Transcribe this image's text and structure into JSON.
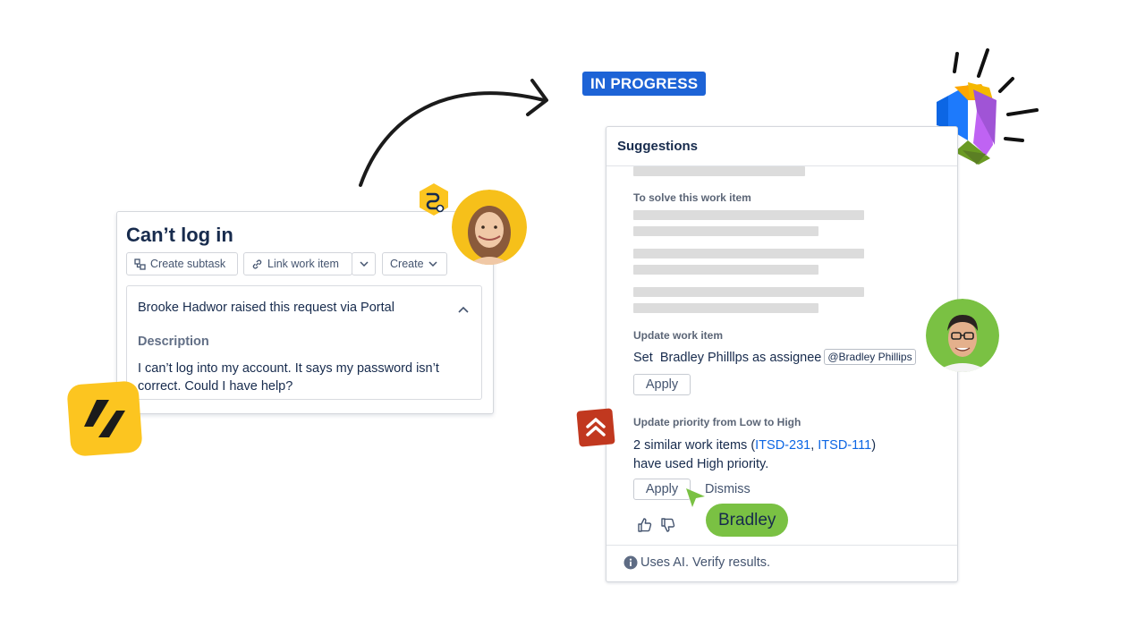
{
  "status_badge": "IN PROGRESS",
  "left_card": {
    "title": "Can’t log in",
    "toolbar": {
      "create_subtask": "Create subtask",
      "link_work_item": "Link work item",
      "create": "Create"
    },
    "raised_by": "Brooke Hadwor raised this request via Portal",
    "description_label": "Description",
    "description_text": "I can’t log into my account. It says my password isn’t correct. Could I have help?"
  },
  "suggestions": {
    "title": "Suggestions",
    "solve_label": "To solve this work item",
    "update_label": "Update work item",
    "update_text": "Set  Bradley Philllps as assignee",
    "mention": "@Bradley Phillips",
    "apply_label": "Apply",
    "priority_label": "Update priority from Low to High",
    "priority_text_prefix": "2 similar work items (",
    "link1": "ITSD-231",
    "comma": ", ",
    "link2": "ITSD-111",
    "priority_text_suffix": ")",
    "priority_text_line2": "have used High priority.",
    "dismiss_label": "Dismiss",
    "footer": "Uses AI. Verify results."
  },
  "cursor_label": "Bradley",
  "colors": {
    "badge_blue": "#1d63d6",
    "link_blue": "#0c66e4",
    "cursor_green": "#7ac143",
    "logo_yellow": "#fcc520",
    "priority_red": "#c1381f"
  },
  "icons": [
    "curved-arrow-icon",
    "subtask-icon",
    "link-icon",
    "chevron-down-icon",
    "chevron-up-icon",
    "jira-service-icon",
    "automation-hex-icon",
    "priority-high-icon",
    "thumbs-up-icon",
    "thumbs-down-icon",
    "info-icon",
    "cursor-pointer-icon",
    "ai-logo-icon"
  ]
}
